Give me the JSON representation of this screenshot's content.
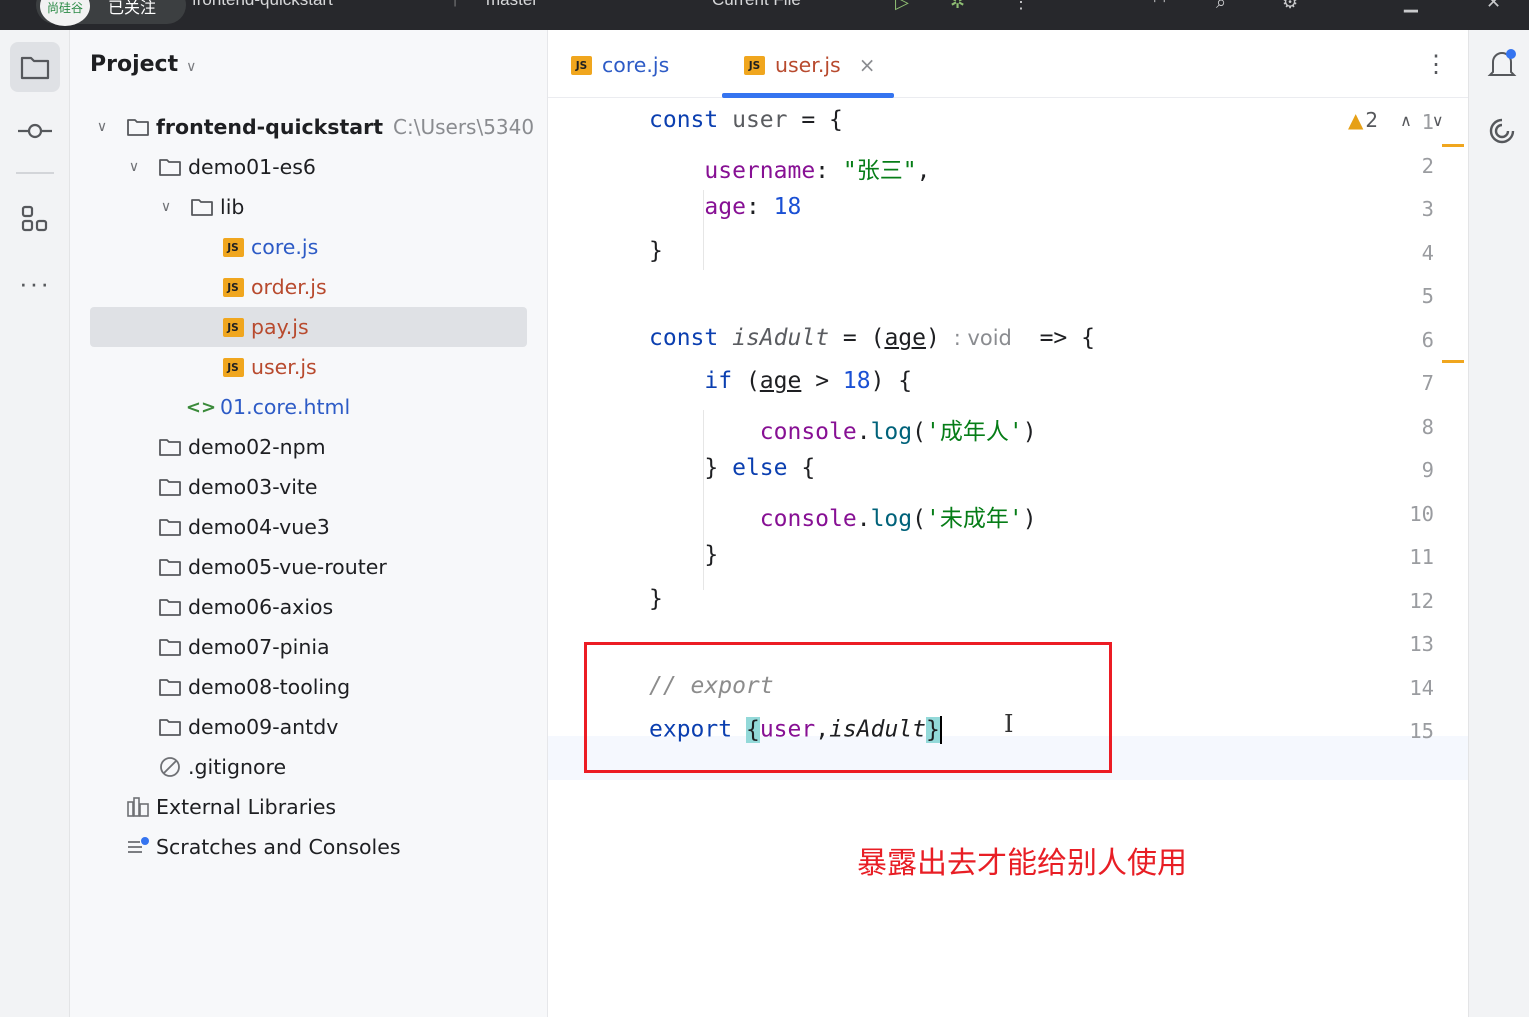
{
  "titlebar": {
    "follow_avatar": "尚硅谷",
    "follow_label": "已关注",
    "project_name": "frontend-quickstart",
    "branch": "master",
    "run_config": "Current File"
  },
  "project_panel": {
    "title": "Project",
    "tree": [
      {
        "label": "frontend-quickstart",
        "path": "C:\\Users\\5340",
        "type": "folder-root"
      },
      {
        "label": "demo01-es6",
        "type": "folder"
      },
      {
        "label": "lib",
        "type": "folder"
      },
      {
        "label": "core.js",
        "type": "js"
      },
      {
        "label": "order.js",
        "type": "js"
      },
      {
        "label": "pay.js",
        "type": "js"
      },
      {
        "label": "user.js",
        "type": "js"
      },
      {
        "label": "01.core.html",
        "type": "html"
      },
      {
        "label": "demo02-npm",
        "type": "folder"
      },
      {
        "label": "demo03-vite",
        "type": "folder"
      },
      {
        "label": "demo04-vue3",
        "type": "folder"
      },
      {
        "label": "demo05-vue-router",
        "type": "folder"
      },
      {
        "label": "demo06-axios",
        "type": "folder"
      },
      {
        "label": "demo07-pinia",
        "type": "folder"
      },
      {
        "label": "demo08-tooling",
        "type": "folder"
      },
      {
        "label": "demo09-antdv",
        "type": "folder"
      },
      {
        "label": ".gitignore",
        "type": "ignore"
      },
      {
        "label": "External Libraries",
        "type": "libs"
      },
      {
        "label": "Scratches and Consoles",
        "type": "scratches"
      }
    ]
  },
  "editor": {
    "tabs": [
      {
        "label": "core.js",
        "active": false
      },
      {
        "label": "user.js",
        "active": true
      }
    ],
    "badge_icon": "JS",
    "close_icon": "×",
    "warning_count": "2",
    "line_numbers": [
      "1",
      "2",
      "3",
      "4",
      "5",
      "6",
      "7",
      "8",
      "9",
      "10",
      "11",
      "12",
      "13",
      "14",
      "15"
    ],
    "code": {
      "l1_kw": "const",
      "l1_name": "user",
      "l1_rest": " = {",
      "l2_prop": "username",
      "l2_colon": ": ",
      "l2_str": "\"张三\"",
      "l2_comma": ",",
      "l3_prop": "age",
      "l3_colon": ": ",
      "l3_num": "18",
      "l4": "}",
      "l6_kw": "const",
      "l6_fn": "isAdult",
      "l6_eq": " = (",
      "l6_param": "age",
      "l6_close": ") ",
      "l6_hint": ": void",
      "l6_arrow": "  => {",
      "l7_kw": "if",
      "l7_open": " (",
      "l7_param": "age",
      "l7_op": " > ",
      "l7_num": "18",
      "l7_close": ") {",
      "l8_obj": "console",
      "l8_dot": ".",
      "l8_fn": "log",
      "l8_open": "(",
      "l8_str": "'成年人'",
      "l8_close": ")",
      "l9_open": "} ",
      "l9_kw": "else",
      "l9_close": " {",
      "l10_obj": "console",
      "l10_dot": ".",
      "l10_fn": "log",
      "l10_open": "(",
      "l10_str": "'未成年'",
      "l10_close": ")",
      "l11": "}",
      "l12": "}",
      "l14_comment": "// export",
      "l15_kw": "export",
      "l15_space": " ",
      "l15_open": "{",
      "l15_user": "user",
      "l15_comma": ",",
      "l15_fn": "isAdult",
      "l15_close": "}"
    }
  },
  "annotation": {
    "text": "暴露出去才能给别人使用",
    "color": "#e81e25"
  },
  "colors": {
    "accent": "#3574f0",
    "keyword": "#0b3fb0",
    "property": "#871094",
    "string": "#067d17",
    "number": "#1a50d4"
  }
}
